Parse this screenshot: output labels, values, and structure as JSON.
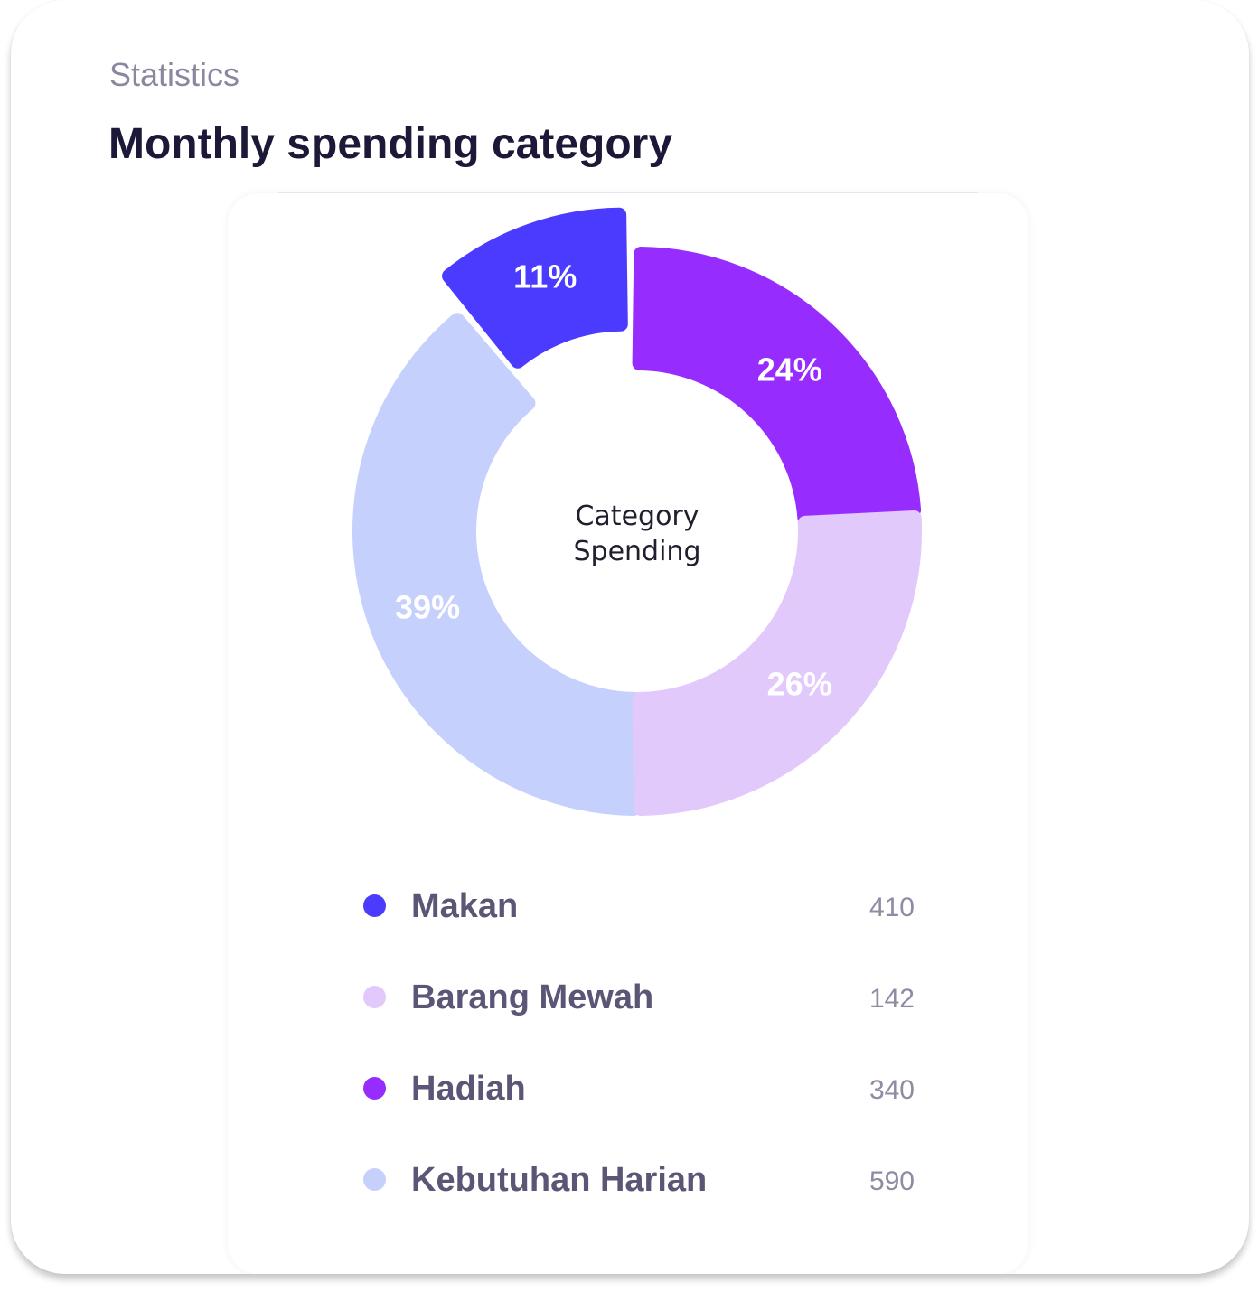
{
  "header": {
    "eyebrow": "Statistics",
    "title": "Monthly spending category"
  },
  "chart_data": {
    "type": "pie",
    "center_label_line1": "Category",
    "center_label_line2": "Spending",
    "slices": [
      {
        "name": "Kebutuhan Harian",
        "percent": 39,
        "label": "39%",
        "value": 590,
        "color": "#c6d0fd"
      },
      {
        "name": "Makan",
        "percent": 11,
        "label": "11%",
        "value": 410,
        "color": "#4b3bff"
      },
      {
        "name": "Hadiah",
        "percent": 24,
        "label": "24%",
        "value": 340,
        "color": "#972cff"
      },
      {
        "name": "Barang Mewah",
        "percent": 26,
        "label": "26%",
        "value": 142,
        "color": "#e2c9fc"
      }
    ]
  },
  "legend": [
    {
      "name": "Makan",
      "value": "410",
      "color": "#4b3bff"
    },
    {
      "name": "Barang Mewah",
      "value": "142",
      "color": "#e2c9fc"
    },
    {
      "name": "Hadiah",
      "value": "340",
      "color": "#972cff"
    },
    {
      "name": "Kebutuhan Harian",
      "value": "590",
      "color": "#c6d0fd"
    }
  ]
}
